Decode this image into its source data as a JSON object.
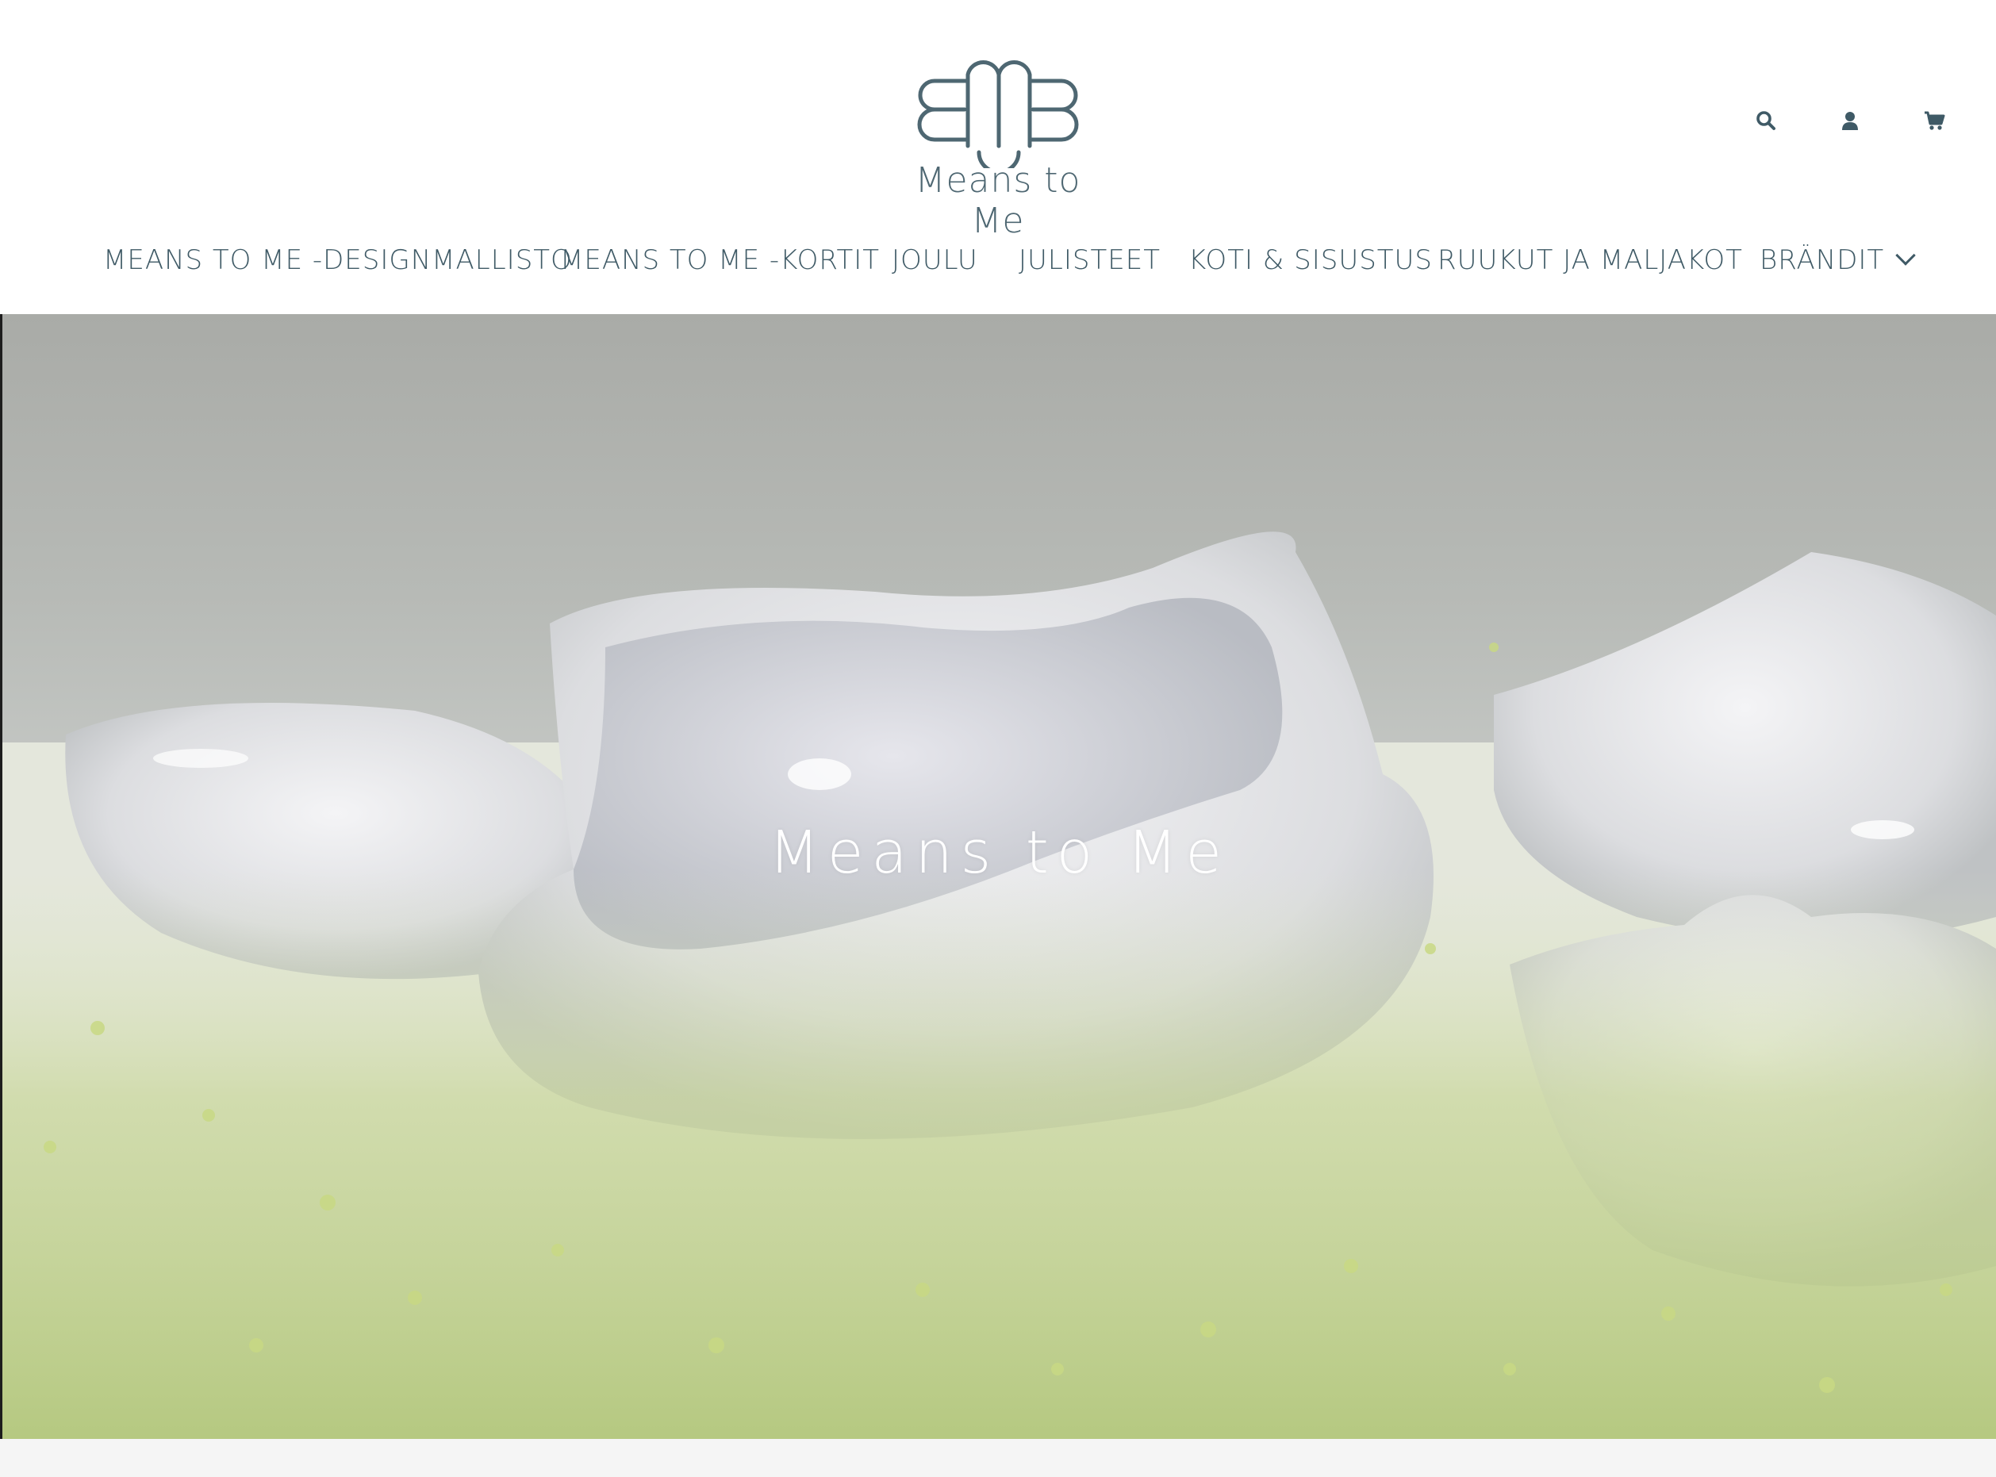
{
  "brand": {
    "logo_mark": "EMB",
    "wordmark": "Means to Me",
    "color": "#4e6772"
  },
  "header": {
    "icons": [
      "search-icon",
      "account-icon",
      "cart-icon"
    ]
  },
  "nav": {
    "items": [
      {
        "label": "MEANS TO ME -DESIGNMALLISTO"
      },
      {
        "label": "MEANS TO ME -KORTIT"
      },
      {
        "label": "JOULU"
      },
      {
        "label": "JULISTEET"
      },
      {
        "label": "KOTI & SISUSTUS"
      },
      {
        "label": "RUUKUT JA MALJAKOT"
      },
      {
        "label": "BRÄNDIT",
        "has_dropdown": true
      }
    ],
    "text_color": "#3f5a66"
  },
  "hero": {
    "title": "Means to Me",
    "image_subject": "white ceramic wavy bowls with green gypsophila flowers"
  }
}
